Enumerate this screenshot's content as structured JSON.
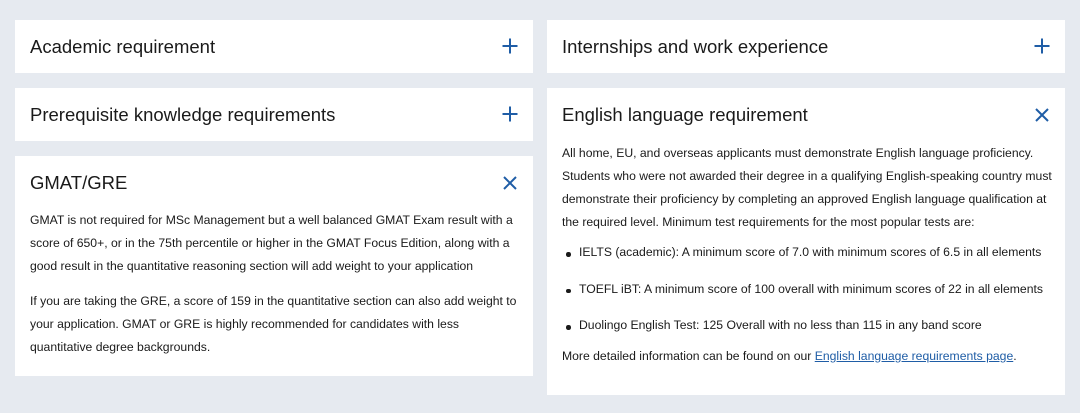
{
  "colors": {
    "page_background": "#e6eaf0",
    "panel_background": "#ffffff",
    "icon_accent": "#1f5da6",
    "link": "#1f5da6",
    "text": "#1a1a1a"
  },
  "left_column": {
    "academic": {
      "title": "Academic requirement",
      "state": "collapsed",
      "icon": "plus-icon"
    },
    "prerequisite": {
      "title": "Prerequisite knowledge requirements",
      "state": "collapsed",
      "icon": "plus-icon"
    },
    "gmat": {
      "title": "GMAT/GRE",
      "state": "expanded",
      "icon": "close-icon",
      "paragraph1": "GMAT is not required for MSc Management but a well balanced GMAT Exam result with a score of 650+, or in the 75th percentile or higher in the GMAT Focus Edition, along with a good result in the quantitative reasoning section will add weight to your application",
      "paragraph2": "If you are taking the GRE, a score of 159 in the quantitative section can also add weight to your application. GMAT or GRE is highly recommended for candidates with less quantitative degree backgrounds."
    }
  },
  "right_column": {
    "internships": {
      "title": "Internships and work experience",
      "state": "collapsed",
      "icon": "plus-icon"
    },
    "english": {
      "title": "English language requirement",
      "state": "expanded",
      "icon": "close-icon",
      "intro": "All home, EU, and overseas applicants must demonstrate English language proficiency. Students who were not awarded their degree in a qualifying English-speaking country must demonstrate their proficiency by completing an approved English language qualification at the required level. Minimum test requirements for the most popular tests are:",
      "bullets": [
        "IELTS (academic): A minimum score of 7.0 with minimum scores of 6.5 in all elements",
        "TOEFL iBT: A minimum score of 100 overall with minimum scores of 22 in all elements",
        "Duolingo English Test: 125 Overall with no less than 115 in any band score"
      ],
      "footer_prefix": "More detailed information can be found on our ",
      "footer_link": "English language requirements page",
      "footer_suffix": "."
    }
  }
}
